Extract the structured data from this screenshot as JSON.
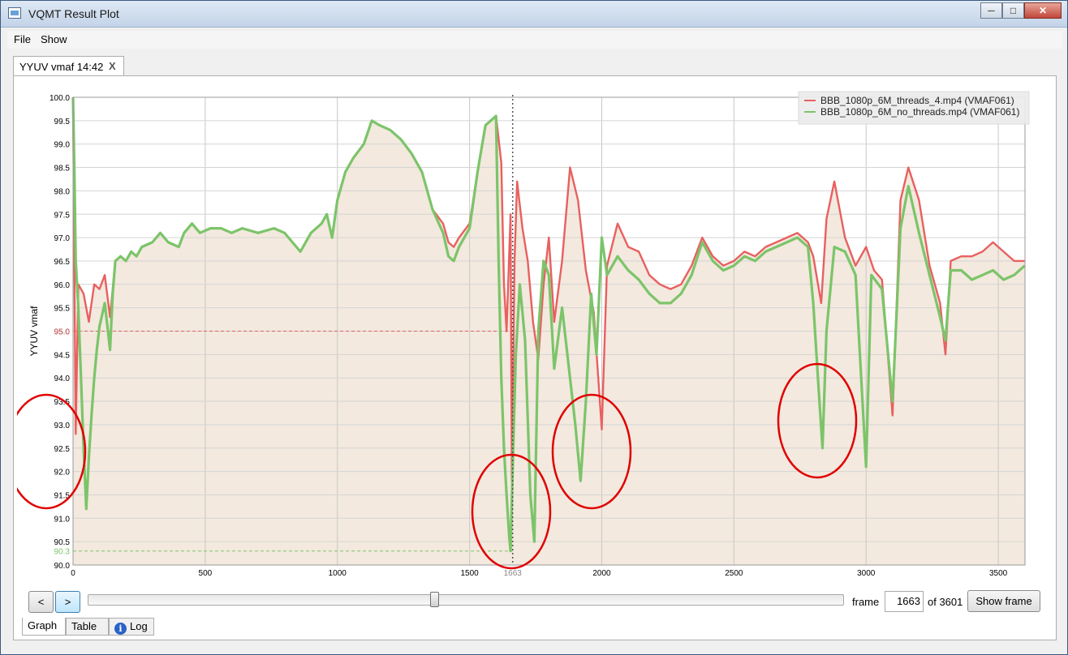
{
  "window": {
    "title": "VQMT Result Plot"
  },
  "menu": {
    "file": "File",
    "show": "Show"
  },
  "doc_tab": {
    "label": "YYUV vmaf 14:42",
    "close": "X"
  },
  "controls": {
    "prev": "<",
    "next": ">",
    "frame_label": "frame",
    "frame_value": "1663",
    "of_total": "of 3601",
    "show_frame": "Show frame",
    "slider_value": 1663,
    "slider_max": 3601
  },
  "bottom_tabs": {
    "graph": "Graph",
    "table": "Table",
    "log": "Log"
  },
  "chart_data": {
    "type": "line",
    "title": "",
    "xlabel": "",
    "ylabel": "YYUV vmaf",
    "xlim": [
      0,
      3601
    ],
    "ylim": [
      90.0,
      100.0
    ],
    "x_ticks": [
      "0",
      "500",
      "1000",
      "1500",
      "2000",
      "2500",
      "3000",
      "3500"
    ],
    "y_ticks": [
      "90.0",
      "90.5",
      "91.0",
      "91.5",
      "92.0",
      "92.5",
      "93.0",
      "93.5",
      "94.0",
      "94.5",
      "95.0",
      "95.5",
      "96.0",
      "96.5",
      "97.0",
      "97.5",
      "98.0",
      "98.5",
      "99.0",
      "99.5",
      "100.0"
    ],
    "cursor": {
      "frame": 1663,
      "label": "1663"
    },
    "reference_lines": [
      {
        "value": 95.0,
        "label": "95.0",
        "color": "#e06060"
      },
      {
        "value": 90.3,
        "label": "90.3",
        "color": "#7cc46a"
      }
    ],
    "series": [
      {
        "name": "BBB_1080p_6M_threads_4.mp4 (VMAF061)",
        "color": "#e86060",
        "points": [
          [
            0,
            100
          ],
          [
            5,
            96.5
          ],
          [
            10,
            92.8
          ],
          [
            20,
            96
          ],
          [
            40,
            95.8
          ],
          [
            60,
            95.2
          ],
          [
            80,
            96
          ],
          [
            100,
            95.9
          ],
          [
            120,
            96.2
          ],
          [
            140,
            95.3
          ],
          [
            160,
            96.5
          ],
          [
            180,
            96.6
          ],
          [
            200,
            96.5
          ],
          [
            220,
            96.7
          ],
          [
            240,
            96.6
          ],
          [
            260,
            96.8
          ],
          [
            300,
            96.9
          ],
          [
            330,
            97.1
          ],
          [
            360,
            96.9
          ],
          [
            400,
            96.8
          ],
          [
            420,
            97.1
          ],
          [
            450,
            97.3
          ],
          [
            480,
            97.1
          ],
          [
            520,
            97.2
          ],
          [
            560,
            97.2
          ],
          [
            600,
            97.1
          ],
          [
            640,
            97.2
          ],
          [
            700,
            97.1
          ],
          [
            760,
            97.2
          ],
          [
            800,
            97.1
          ],
          [
            830,
            96.9
          ],
          [
            860,
            96.7
          ],
          [
            900,
            97.1
          ],
          [
            940,
            97.3
          ],
          [
            960,
            97.5
          ],
          [
            980,
            97.0
          ],
          [
            1000,
            97.8
          ],
          [
            1030,
            98.4
          ],
          [
            1060,
            98.7
          ],
          [
            1100,
            99.0
          ],
          [
            1130,
            99.5
          ],
          [
            1160,
            99.4
          ],
          [
            1200,
            99.3
          ],
          [
            1240,
            99.1
          ],
          [
            1280,
            98.8
          ],
          [
            1320,
            98.4
          ],
          [
            1360,
            97.6
          ],
          [
            1400,
            97.3
          ],
          [
            1420,
            96.9
          ],
          [
            1440,
            96.8
          ],
          [
            1460,
            97.0
          ],
          [
            1500,
            97.3
          ],
          [
            1530,
            98.4
          ],
          [
            1560,
            99.4
          ],
          [
            1600,
            99.6
          ],
          [
            1620,
            98.6
          ],
          [
            1630,
            96.0
          ],
          [
            1640,
            95.0
          ],
          [
            1655,
            97.5
          ],
          [
            1660,
            91.8
          ],
          [
            1670,
            96.5
          ],
          [
            1680,
            98.2
          ],
          [
            1700,
            97.2
          ],
          [
            1720,
            96.5
          ],
          [
            1740,
            95.2
          ],
          [
            1760,
            94.4
          ],
          [
            1780,
            96.0
          ],
          [
            1800,
            97.0
          ],
          [
            1820,
            95.2
          ],
          [
            1850,
            96.5
          ],
          [
            1880,
            98.5
          ],
          [
            1910,
            97.8
          ],
          [
            1940,
            96.3
          ],
          [
            1970,
            95.4
          ],
          [
            2000,
            92.9
          ],
          [
            2020,
            96.4
          ],
          [
            2060,
            97.3
          ],
          [
            2100,
            96.8
          ],
          [
            2140,
            96.7
          ],
          [
            2180,
            96.2
          ],
          [
            2220,
            96.0
          ],
          [
            2260,
            95.9
          ],
          [
            2300,
            96.0
          ],
          [
            2340,
            96.4
          ],
          [
            2380,
            97.0
          ],
          [
            2420,
            96.6
          ],
          [
            2460,
            96.4
          ],
          [
            2500,
            96.5
          ],
          [
            2540,
            96.7
          ],
          [
            2580,
            96.6
          ],
          [
            2620,
            96.8
          ],
          [
            2660,
            96.9
          ],
          [
            2700,
            97.0
          ],
          [
            2740,
            97.1
          ],
          [
            2780,
            96.9
          ],
          [
            2800,
            96.6
          ],
          [
            2830,
            95.6
          ],
          [
            2850,
            97.4
          ],
          [
            2880,
            98.2
          ],
          [
            2920,
            97.0
          ],
          [
            2960,
            96.4
          ],
          [
            3000,
            96.8
          ],
          [
            3030,
            96.3
          ],
          [
            3060,
            96.1
          ],
          [
            3100,
            93.2
          ],
          [
            3130,
            97.8
          ],
          [
            3160,
            98.5
          ],
          [
            3200,
            97.8
          ],
          [
            3240,
            96.4
          ],
          [
            3280,
            95.6
          ],
          [
            3300,
            94.5
          ],
          [
            3320,
            96.5
          ],
          [
            3360,
            96.6
          ],
          [
            3400,
            96.6
          ],
          [
            3440,
            96.7
          ],
          [
            3480,
            96.9
          ],
          [
            3520,
            96.7
          ],
          [
            3560,
            96.5
          ],
          [
            3600,
            96.5
          ]
        ]
      },
      {
        "name": "BBB_1080p_6M_no_threads.mp4 (VMAF061)",
        "color": "#7cc46a",
        "points": [
          [
            0,
            100
          ],
          [
            5,
            98.5
          ],
          [
            10,
            96.5
          ],
          [
            20,
            95.5
          ],
          [
            30,
            94.0
          ],
          [
            40,
            92.5
          ],
          [
            50,
            91.2
          ],
          [
            60,
            92.3
          ],
          [
            70,
            93.2
          ],
          [
            80,
            94.0
          ],
          [
            90,
            94.6
          ],
          [
            100,
            95.1
          ],
          [
            120,
            95.6
          ],
          [
            140,
            94.6
          ],
          [
            150,
            95.8
          ],
          [
            160,
            96.5
          ],
          [
            180,
            96.6
          ],
          [
            200,
            96.5
          ],
          [
            220,
            96.7
          ],
          [
            240,
            96.6
          ],
          [
            260,
            96.8
          ],
          [
            300,
            96.9
          ],
          [
            330,
            97.1
          ],
          [
            360,
            96.9
          ],
          [
            400,
            96.8
          ],
          [
            420,
            97.1
          ],
          [
            450,
            97.3
          ],
          [
            480,
            97.1
          ],
          [
            520,
            97.2
          ],
          [
            560,
            97.2
          ],
          [
            600,
            97.1
          ],
          [
            640,
            97.2
          ],
          [
            700,
            97.1
          ],
          [
            760,
            97.2
          ],
          [
            800,
            97.1
          ],
          [
            830,
            96.9
          ],
          [
            860,
            96.7
          ],
          [
            900,
            97.1
          ],
          [
            940,
            97.3
          ],
          [
            960,
            97.5
          ],
          [
            980,
            97.0
          ],
          [
            1000,
            97.8
          ],
          [
            1030,
            98.4
          ],
          [
            1060,
            98.7
          ],
          [
            1100,
            99.0
          ],
          [
            1130,
            99.5
          ],
          [
            1160,
            99.4
          ],
          [
            1200,
            99.3
          ],
          [
            1240,
            99.1
          ],
          [
            1280,
            98.8
          ],
          [
            1320,
            98.4
          ],
          [
            1360,
            97.6
          ],
          [
            1400,
            97.1
          ],
          [
            1420,
            96.6
          ],
          [
            1440,
            96.5
          ],
          [
            1460,
            96.8
          ],
          [
            1500,
            97.2
          ],
          [
            1530,
            98.4
          ],
          [
            1560,
            99.4
          ],
          [
            1600,
            99.6
          ],
          [
            1610,
            96.5
          ],
          [
            1620,
            94.0
          ],
          [
            1630,
            92.5
          ],
          [
            1640,
            91.5
          ],
          [
            1650,
            90.6
          ],
          [
            1655,
            90.3
          ],
          [
            1665,
            92.5
          ],
          [
            1675,
            94.5
          ],
          [
            1690,
            96.0
          ],
          [
            1710,
            94.8
          ],
          [
            1730,
            91.5
          ],
          [
            1745,
            90.5
          ],
          [
            1760,
            95.0
          ],
          [
            1780,
            96.5
          ],
          [
            1800,
            96.2
          ],
          [
            1820,
            94.2
          ],
          [
            1850,
            95.5
          ],
          [
            1880,
            94.0
          ],
          [
            1900,
            93.0
          ],
          [
            1920,
            91.8
          ],
          [
            1940,
            93.5
          ],
          [
            1960,
            95.8
          ],
          [
            1980,
            94.5
          ],
          [
            2000,
            97.0
          ],
          [
            2020,
            96.2
          ],
          [
            2060,
            96.6
          ],
          [
            2100,
            96.3
          ],
          [
            2140,
            96.1
          ],
          [
            2180,
            95.8
          ],
          [
            2220,
            95.6
          ],
          [
            2260,
            95.6
          ],
          [
            2300,
            95.8
          ],
          [
            2340,
            96.2
          ],
          [
            2380,
            96.9
          ],
          [
            2420,
            96.5
          ],
          [
            2460,
            96.3
          ],
          [
            2500,
            96.4
          ],
          [
            2540,
            96.6
          ],
          [
            2580,
            96.5
          ],
          [
            2620,
            96.7
          ],
          [
            2660,
            96.8
          ],
          [
            2700,
            96.9
          ],
          [
            2740,
            97.0
          ],
          [
            2780,
            96.8
          ],
          [
            2800,
            95.6
          ],
          [
            2820,
            93.8
          ],
          [
            2835,
            92.5
          ],
          [
            2850,
            95.0
          ],
          [
            2880,
            96.8
          ],
          [
            2920,
            96.7
          ],
          [
            2960,
            96.2
          ],
          [
            3000,
            92.1
          ],
          [
            3020,
            96.2
          ],
          [
            3060,
            95.9
          ],
          [
            3100,
            93.5
          ],
          [
            3130,
            97.2
          ],
          [
            3160,
            98.1
          ],
          [
            3200,
            97.1
          ],
          [
            3240,
            96.2
          ],
          [
            3280,
            95.3
          ],
          [
            3300,
            94.8
          ],
          [
            3320,
            96.3
          ],
          [
            3360,
            96.3
          ],
          [
            3400,
            96.1
          ],
          [
            3440,
            96.2
          ],
          [
            3480,
            96.3
          ],
          [
            3520,
            96.1
          ],
          [
            3560,
            96.2
          ],
          [
            3600,
            96.4
          ]
        ]
      }
    ]
  }
}
